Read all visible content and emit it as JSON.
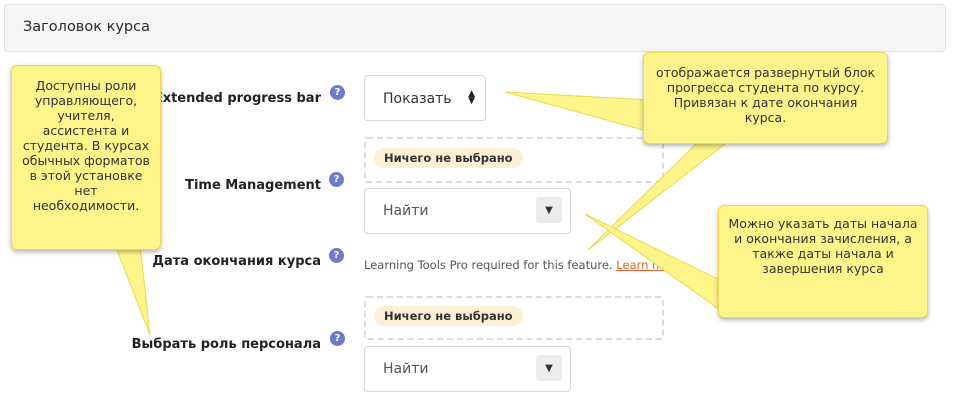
{
  "header": {
    "title": "Заголовок курса"
  },
  "fields": {
    "extended_progress_bar": {
      "label": "Extended progress bar",
      "help": "?",
      "value": "Показать"
    },
    "time_management": {
      "label": "Time Management",
      "help": "?",
      "badge": "Ничего не выбрано",
      "search_placeholder": "Найти"
    },
    "course_end_date": {
      "label": "Дата окончания курса",
      "help": "?",
      "info": "Learning Tools Pro required for this feature.",
      "link": "Learn mo"
    },
    "staff_role": {
      "label": "Выбрать роль персонала",
      "help": "?",
      "badge": "Ничего не выбрано",
      "search_placeholder": "Найти"
    }
  },
  "callouts": {
    "left": "Доступны роли управляющего, учителя, ассистента и студента. В курсах обычных форматов в этой установке нет необходимости.",
    "top_right": "отображается развернутый блок прогресса студента по курсу. Привязан к дате окончания курса.",
    "bottom_right": "Можно указать даты начала и окончания зачисления, а также даты начала и завершения курса"
  },
  "colors": {
    "help": "#6a7bd2",
    "callout": "#fdf48a",
    "badge": "#fdf0d5",
    "link": "#e0662d"
  }
}
